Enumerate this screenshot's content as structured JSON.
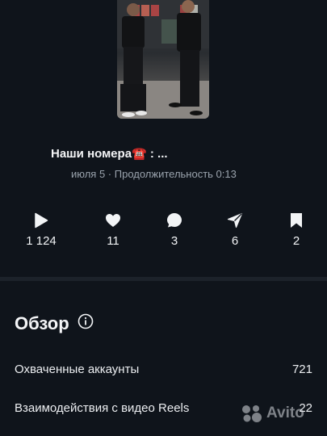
{
  "post": {
    "caption": "Наши номера☎️ : ...",
    "meta": "июля 5 · Продолжительность 0:13"
  },
  "stats": [
    {
      "icon": "play-icon",
      "value": "1 124"
    },
    {
      "icon": "heart-icon",
      "value": "11"
    },
    {
      "icon": "comment-icon",
      "value": "3"
    },
    {
      "icon": "send-icon",
      "value": "6"
    },
    {
      "icon": "bookmark-icon",
      "value": "2"
    }
  ],
  "overview": {
    "title": "Обзор",
    "rows": [
      {
        "label": "Охваченные аккаунты",
        "value": "721"
      },
      {
        "label": "Взаимодействия с видео Reels",
        "value": "22"
      }
    ]
  },
  "watermark": {
    "text": "Avito"
  }
}
